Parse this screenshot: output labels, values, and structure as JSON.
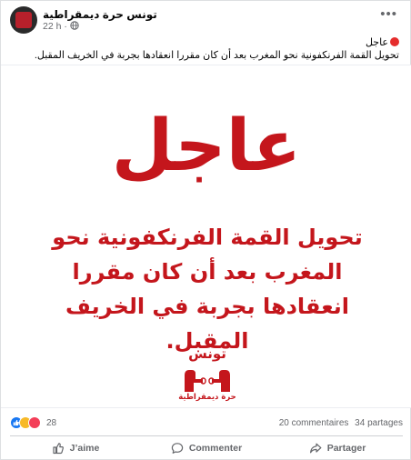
{
  "post": {
    "page_name": "تونس حرة ديمقراطية",
    "time": "22 h",
    "caption_prefix": "عاجل",
    "caption_body": "تحويل القمة الفرنكفونية  نحو المغرب بعد أن كان مقررا انعقادها بجربة في الخريف المقبل."
  },
  "image": {
    "headline_big": "عاجل",
    "headline_body": "تحويل القمة الفرنكفونية نحو المغرب بعد أن كان مقررا انعقادها بجربة في الخريف المقبل.",
    "logo_title": "تونس",
    "logo_subtitle": "حرة ديمقراطية"
  },
  "stats": {
    "reaction_count": "28",
    "comments": "20 commentaires",
    "shares": "34 partages"
  },
  "actions": {
    "like": "J’aime",
    "comment": "Commenter",
    "share": "Partager"
  },
  "colors": {
    "accent_red": "#c4161c",
    "facebook_blue": "#1877f2"
  },
  "icons": {
    "reactions": [
      "like-icon",
      "haha-icon",
      "love-icon"
    ],
    "actions": [
      "thumb-up-icon",
      "comment-bubble-icon",
      "share-arrow-icon"
    ]
  }
}
